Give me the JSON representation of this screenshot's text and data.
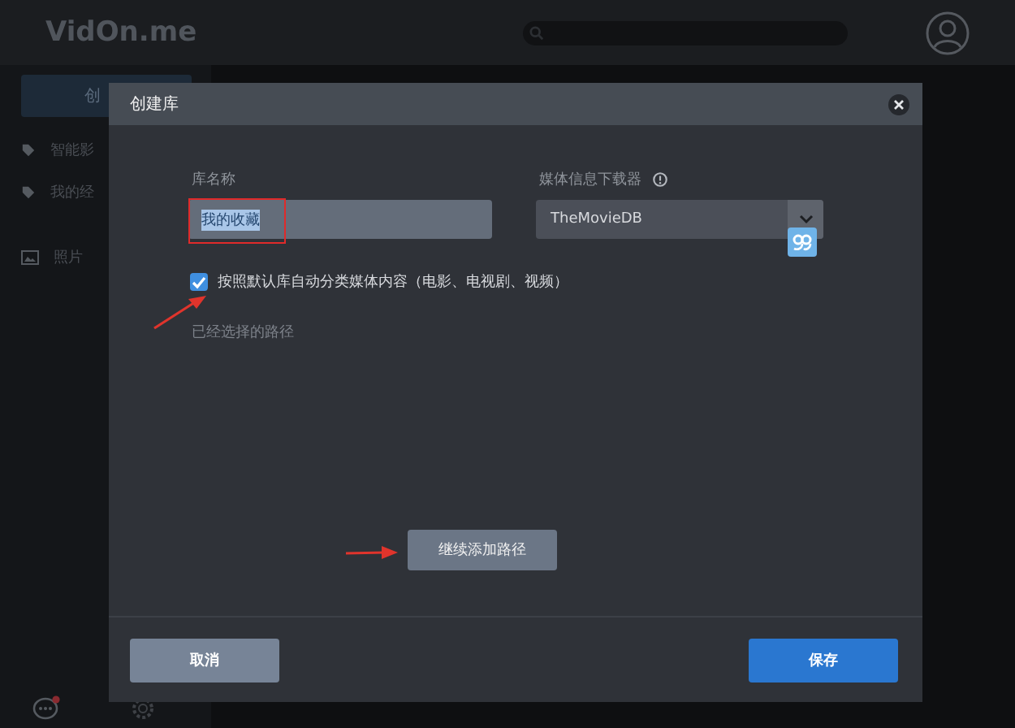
{
  "app": {
    "logo": "VidOn.me",
    "sidebar": {
      "create_button": "创",
      "items": [
        {
          "label": "智能影"
        },
        {
          "label": "我的经"
        },
        {
          "label": "照片"
        }
      ]
    }
  },
  "dialog": {
    "title": "创建库",
    "name_field": {
      "label": "库名称",
      "value": "我的收藏",
      "selected": true
    },
    "downloader": {
      "label": "媒体信息下载器",
      "value": "TheMovieDB"
    },
    "auto_classify": {
      "label": "按照默认库自动分类媒体内容（电影、电视剧、视频）",
      "checked": true
    },
    "paths_label": "已经选择的路径",
    "add_path_button": "继续添加路径",
    "buttons": [
      {
        "label": "取消",
        "kind": "secondary"
      },
      {
        "label": "保存",
        "kind": "primary"
      }
    ]
  }
}
